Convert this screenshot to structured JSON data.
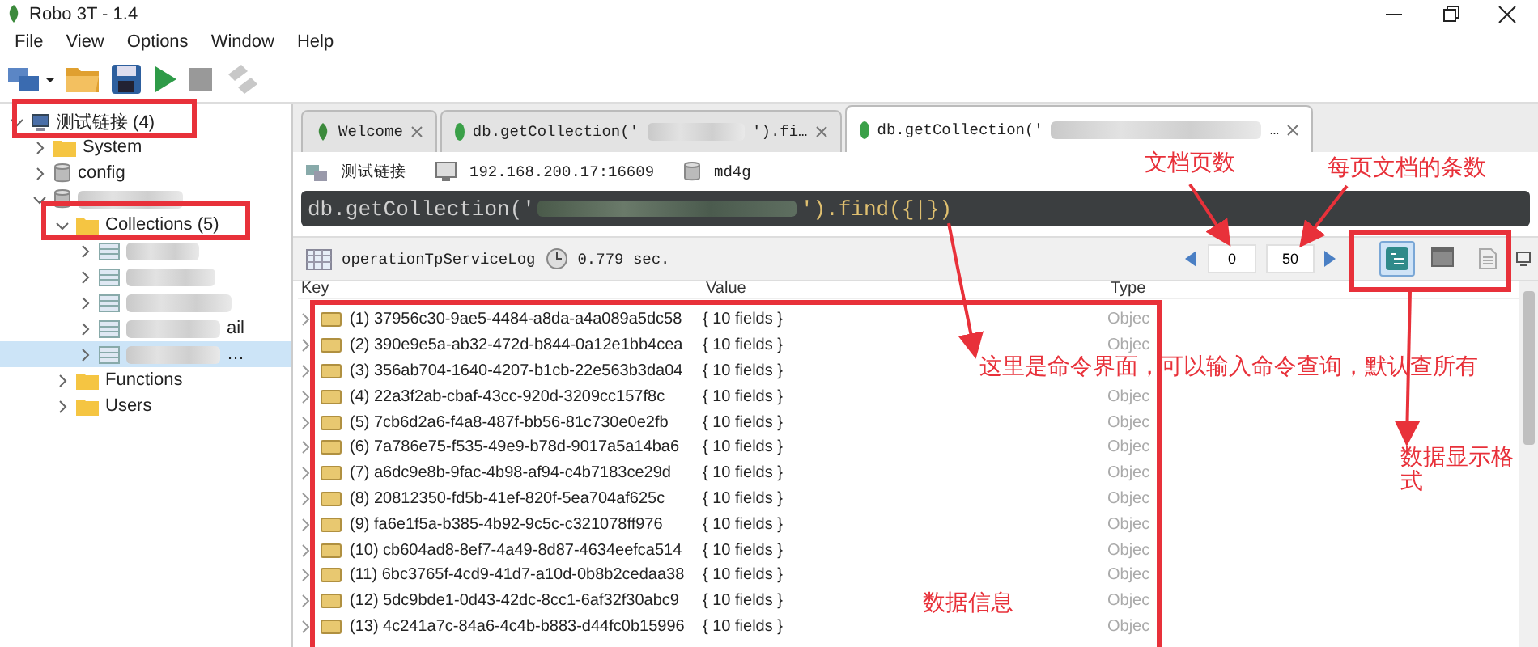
{
  "window": {
    "title": "Robo 3T - 1.4"
  },
  "menu": [
    "File",
    "View",
    "Options",
    "Window",
    "Help"
  ],
  "toolbar": [
    {
      "kind": "connect"
    },
    {
      "kind": "open"
    },
    {
      "kind": "save"
    },
    {
      "kind": "run"
    },
    {
      "kind": "stop"
    },
    {
      "kind": "format"
    }
  ],
  "tree": [
    {
      "label": "测试链接 (4)",
      "kind": "server",
      "expanded": true,
      "selected": false,
      "children": [
        {
          "label": "System",
          "kind": "folder",
          "expanded": false,
          "selected": false
        },
        {
          "label": "config",
          "kind": "database",
          "expanded": false,
          "selected": false
        },
        {
          "kind": "database",
          "expanded": true,
          "selected": false,
          "children": [
            {
              "label": "Collections (5)",
              "kind": "folder",
              "expanded": true,
              "selected": false,
              "children": [
                {
                  "kind": "table",
                  "expanded": false,
                  "selected": false
                },
                {
                  "kind": "table",
                  "expanded": false,
                  "selected": false
                },
                {
                  "kind": "table",
                  "expanded": false,
                  "selected": false
                },
                {
                  "kind": "table",
                  "expanded": false,
                  "selected": false,
                  "label": "ail"
                },
                {
                  "kind": "table",
                  "expanded": false,
                  "selected": true,
                  "label": "…"
                }
              ]
            },
            {
              "label": "Functions",
              "kind": "folder",
              "expanded": false,
              "selected": false
            },
            {
              "label": "Users",
              "kind": "folder",
              "expanded": false,
              "selected": false
            }
          ]
        }
      ]
    }
  ],
  "tabs": [
    {
      "kind": "welcome",
      "label": "Welcome",
      "selected": false
    },
    {
      "kind": "query",
      "label": "db.getCollection('",
      "suffix": "').fi…",
      "selected": false
    },
    {
      "kind": "query",
      "label": "db.getCollection('",
      "suffix": "…",
      "selected": true
    }
  ],
  "connection": {
    "name": "测试链接",
    "address": "192.168.200.17:16609",
    "database": "md4g"
  },
  "query": {
    "prefix": "db.getCollection('",
    "suffix": "').find({|})"
  },
  "results_bar": {
    "collection": "operationTpServiceLog",
    "time": "0.779 sec.",
    "page": "0",
    "page_size": "50",
    "views": [
      {
        "kind": "tree",
        "selected": true
      },
      {
        "kind": "table",
        "selected": false
      },
      {
        "kind": "text",
        "selected": false
      }
    ]
  },
  "table": {
    "columns": [
      "Key",
      "Value",
      "Type"
    ],
    "rows": [
      {
        "key": "(1) 37956c30-9ae5-4484-a8da-a4a089a5dc58",
        "value": "{ 10 fields }",
        "type": "Objec"
      },
      {
        "key": "(2) 390e9e5a-ab32-472d-b844-0a12e1bb4cea",
        "value": "{ 10 fields }",
        "type": "Objec"
      },
      {
        "key": "(3) 356ab704-1640-4207-b1cb-22e563b3da04",
        "value": "{ 10 fields }"
      },
      {
        "key": "(4) 22a3f2ab-cbaf-43cc-920d-3209cc157f8c",
        "value": "{ 10 fields }",
        "type": "Objec"
      },
      {
        "key": "(5) 7cb6d2a6-f4a8-487f-bb56-81c730e0e2fb",
        "value": "{ 10 fields }",
        "type": "Objec"
      },
      {
        "key": "(6) 7a786e75-f535-49e9-b78d-9017a5a14ba6",
        "value": "{ 10 fields }",
        "type": "Objec"
      },
      {
        "key": "(7) a6dc9e8b-9fac-4b98-af94-c4b7183ce29d",
        "value": "{ 10 fields }",
        "type": "Objec"
      },
      {
        "key": "(8) 20812350-fd5b-41ef-820f-5ea704af625c",
        "value": "{ 10 fields }",
        "type": "Objec"
      },
      {
        "key": "(9) fa6e1f5a-b385-4b92-9c5c-c321078ff976",
        "value": "{ 10 fields }",
        "type": "Objec"
      },
      {
        "key": "(10) cb604ad8-8ef7-4a49-8d87-4634eefca514",
        "value": "{ 10 fields }",
        "type": "Objec"
      },
      {
        "key": "(11) 6bc3765f-4cd9-41d7-a10d-0b8b2cedaa38",
        "value": "{ 10 fields }",
        "type": "Objec"
      },
      {
        "key": "(12) 5dc9bde1-0d43-42dc-8cc1-6af32f30abc9",
        "value": "{ 10 fields }",
        "type": "Objec"
      },
      {
        "key": "(13) 4c241a7c-84a6-4c4b-b883-d44fc0b15996",
        "value": "{ 10 fields }",
        "type": "Objec"
      }
    ]
  },
  "annotations": [
    {
      "text": "文档页数"
    },
    {
      "text": "每页文档的条数"
    },
    {
      "text": "这里是命令界面，可以输入命令查询，默认查所有"
    },
    {
      "text": "数据显示格式"
    },
    {
      "text": "数据信息"
    }
  ]
}
